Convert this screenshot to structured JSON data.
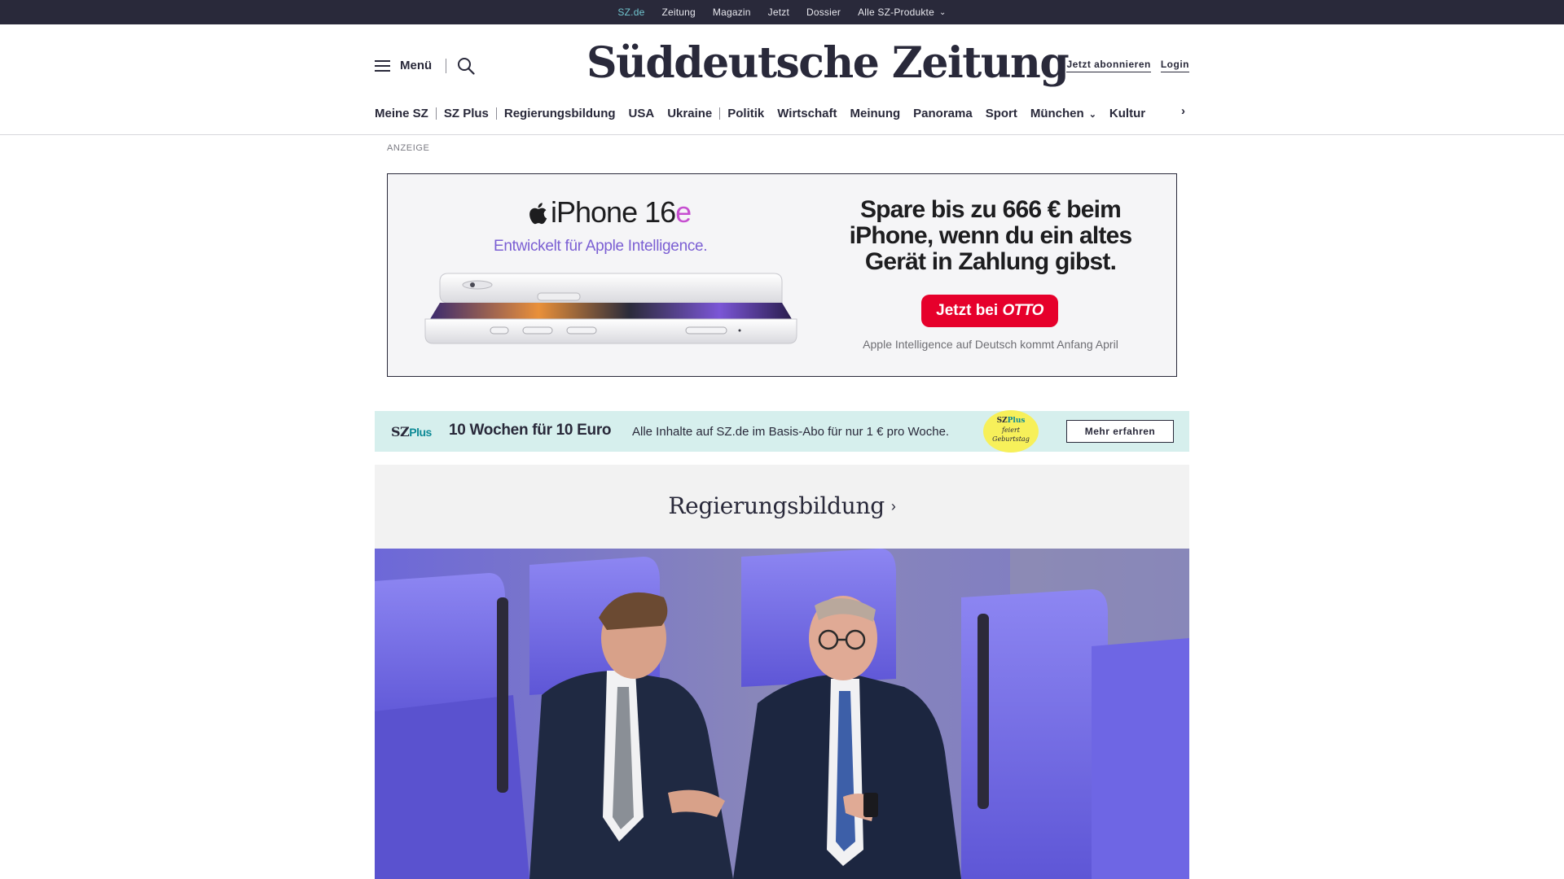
{
  "topbar": {
    "items": [
      {
        "label": "SZ.de",
        "active": true
      },
      {
        "label": "Zeitung"
      },
      {
        "label": "Magazin"
      },
      {
        "label": "Jetzt"
      },
      {
        "label": "Dossier"
      },
      {
        "label": "Alle SZ-Produkte",
        "has_dropdown": true
      }
    ]
  },
  "header": {
    "menu_label": "Menü",
    "logo_text": "Süddeutsche Zeitung",
    "subscribe_label": "Jetzt abonnieren",
    "login_label": "Login"
  },
  "sections": {
    "items": [
      "Meine SZ",
      "SZ Plus",
      "Regierungsbildung",
      "USA",
      "Ukraine",
      "Politik",
      "Wirtschaft",
      "Meinung",
      "Panorama",
      "Sport",
      "München",
      "Kultur"
    ]
  },
  "ad": {
    "label": "ANZEIGE",
    "product_name": "iPhone 16",
    "product_suffix": "e",
    "product_tagline": "Entwickelt für Apple Intelligence.",
    "headline": "Spare bis zu 666 € beim iPhone, wenn du ein altes Gerät in Zahlung gibst.",
    "cta_prefix": "Jetzt bei",
    "cta_brand": "OTTO",
    "footnote": "Apple Intelligence auf Deutsch kommt Anfang April"
  },
  "promo": {
    "logo_sz": "SZ",
    "logo_plus": "Plus",
    "title": "10 Wochen für 10 Euro",
    "text": "Alle Inhalte auf SZ.de im Basis-Abo für nur 1 € pro Woche.",
    "badge_sz": "SZ",
    "badge_plus": "Plus",
    "badge_line1": "feiert",
    "badge_line2": "Geburtstag",
    "button_label": "Mehr erfahren"
  },
  "teaser": {
    "title": "Regierungsbildung"
  },
  "colors": {
    "topbar_bg": "#29293a",
    "active_link": "#71c6d0",
    "promo_bg": "#d6efed",
    "promo_badge": "#f7f05a",
    "ad_cta": "#e6002b",
    "teaser_bg": "#f2f2f2"
  }
}
